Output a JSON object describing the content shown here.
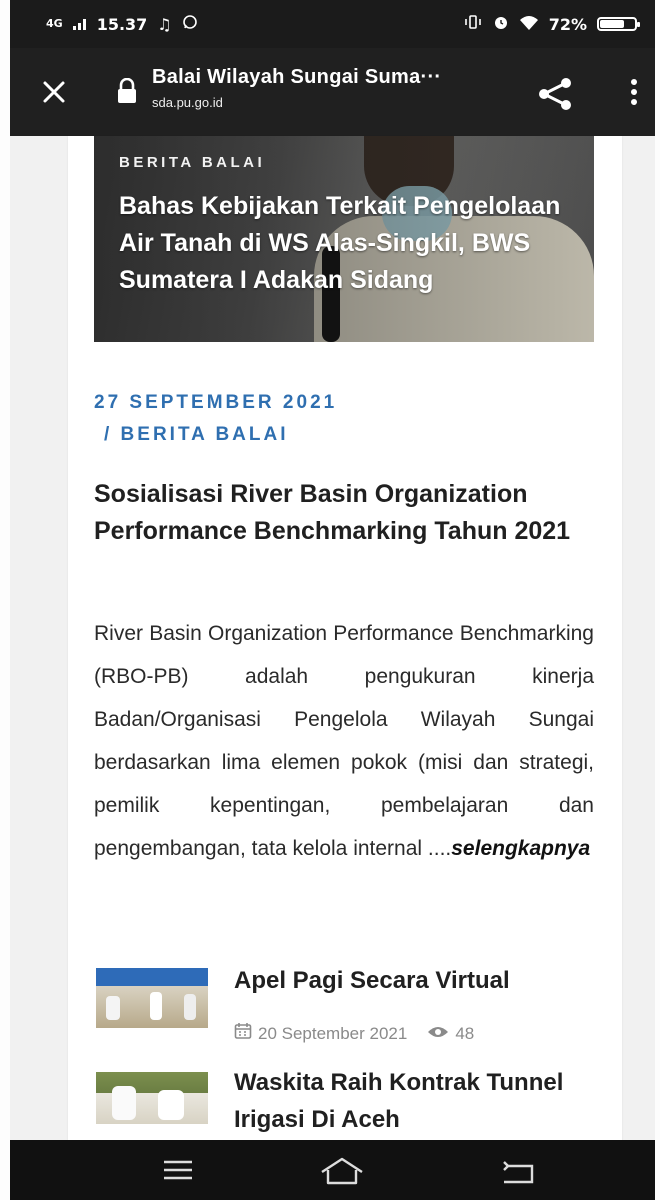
{
  "status_bar": {
    "network": "4G",
    "time": "15.37",
    "battery": "72%",
    "battery_level": 0.72
  },
  "browser": {
    "page_title": "Balai Wilayah Sungai Suma···",
    "url": "sda.pu.go.id"
  },
  "hero": {
    "category": "BERITA BALAI",
    "title": "Bahas Kebijakan Terkait Pengelolaan Air Tanah di WS Alas-Singkil, BWS Sumatera I Adakan Sidang"
  },
  "article": {
    "date": "27 SEPTEMBER 2021",
    "category": "/ BERITA BALAI",
    "title": "Sosialisasi River Basin Organization Performance Benchmarking Tahun 2021",
    "excerpt": "River Basin Organization Performance Benchmarking (RBO-PB) adalah pengukuran kinerja Badan/Organisasi Pengelola Wilayah Sungai berdasarkan lima elemen pokok (misi dan strategi, pemilik kepentingan, pembelajaran dan pengembangan, tata kelola internal ....",
    "read_more": "selengkapnya"
  },
  "related": [
    {
      "title": "Apel Pagi Secara Virtual",
      "date": "20 September 2021",
      "views": "48"
    },
    {
      "title": "Waskita Raih Kontrak Tunnel Irigasi Di Aceh"
    }
  ]
}
